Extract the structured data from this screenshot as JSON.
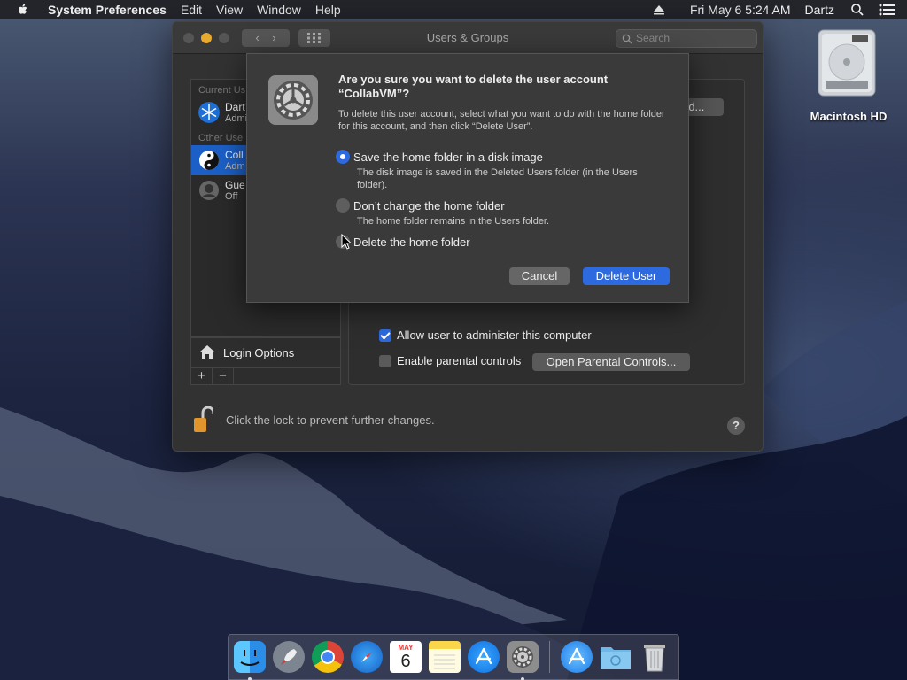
{
  "menubar": {
    "app_name": "System Preferences",
    "menus": [
      "Edit",
      "View",
      "Window",
      "Help"
    ],
    "datetime": "Fri May 6  5:24 AM",
    "user": "Dartz"
  },
  "window": {
    "title": "Users & Groups",
    "search_placeholder": "Search",
    "sidebar": {
      "current_users_header": "Current Us",
      "other_users_header": "Other Use",
      "users": [
        {
          "name": "Dart",
          "role": "Admi"
        },
        {
          "name": "Coll",
          "role": "Adm"
        },
        {
          "name": "Gue",
          "role": "Off"
        }
      ],
      "login_options": "Login Options",
      "add": "+",
      "remove": "−"
    },
    "password_button": "rd...",
    "allow_admin_label": "Allow user to administer this computer",
    "allow_admin_checked": true,
    "parental_label": "Enable parental controls",
    "parental_checked": false,
    "parental_button": "Open Parental Controls...",
    "lock_text": "Click the lock to prevent further changes.",
    "help": "?"
  },
  "sheet": {
    "title": "Are you sure you want to delete the user account “CollabVM”?",
    "message": "To delete this user account, select what you want to do with the home folder for this account, and then click “Delete User”.",
    "options": [
      {
        "label": "Save the home folder in a disk image",
        "desc": "The disk image is saved in the Deleted Users folder (in the Users folder).",
        "selected": true
      },
      {
        "label": "Don’t change the home folder",
        "desc": "The home folder remains in the Users folder.",
        "selected": false
      },
      {
        "label": "Delete the home folder",
        "desc": "",
        "selected": false
      }
    ],
    "cancel": "Cancel",
    "delete": "Delete User"
  },
  "desktop": {
    "disk_label": "Macintosh HD"
  },
  "dock": {
    "calendar_month": "MAY",
    "calendar_day": "6",
    "apps": [
      "finder-icon",
      "launchpad-icon",
      "chrome-icon",
      "safari-icon",
      "calendar-icon",
      "notes-icon",
      "app-store-icon",
      "system-preferences-icon",
      "app-store-icon",
      "downloads-folder-icon",
      "trash-icon"
    ]
  },
  "colors": {
    "accent": "#2d6ae0",
    "selection": "#1b5fc7"
  }
}
